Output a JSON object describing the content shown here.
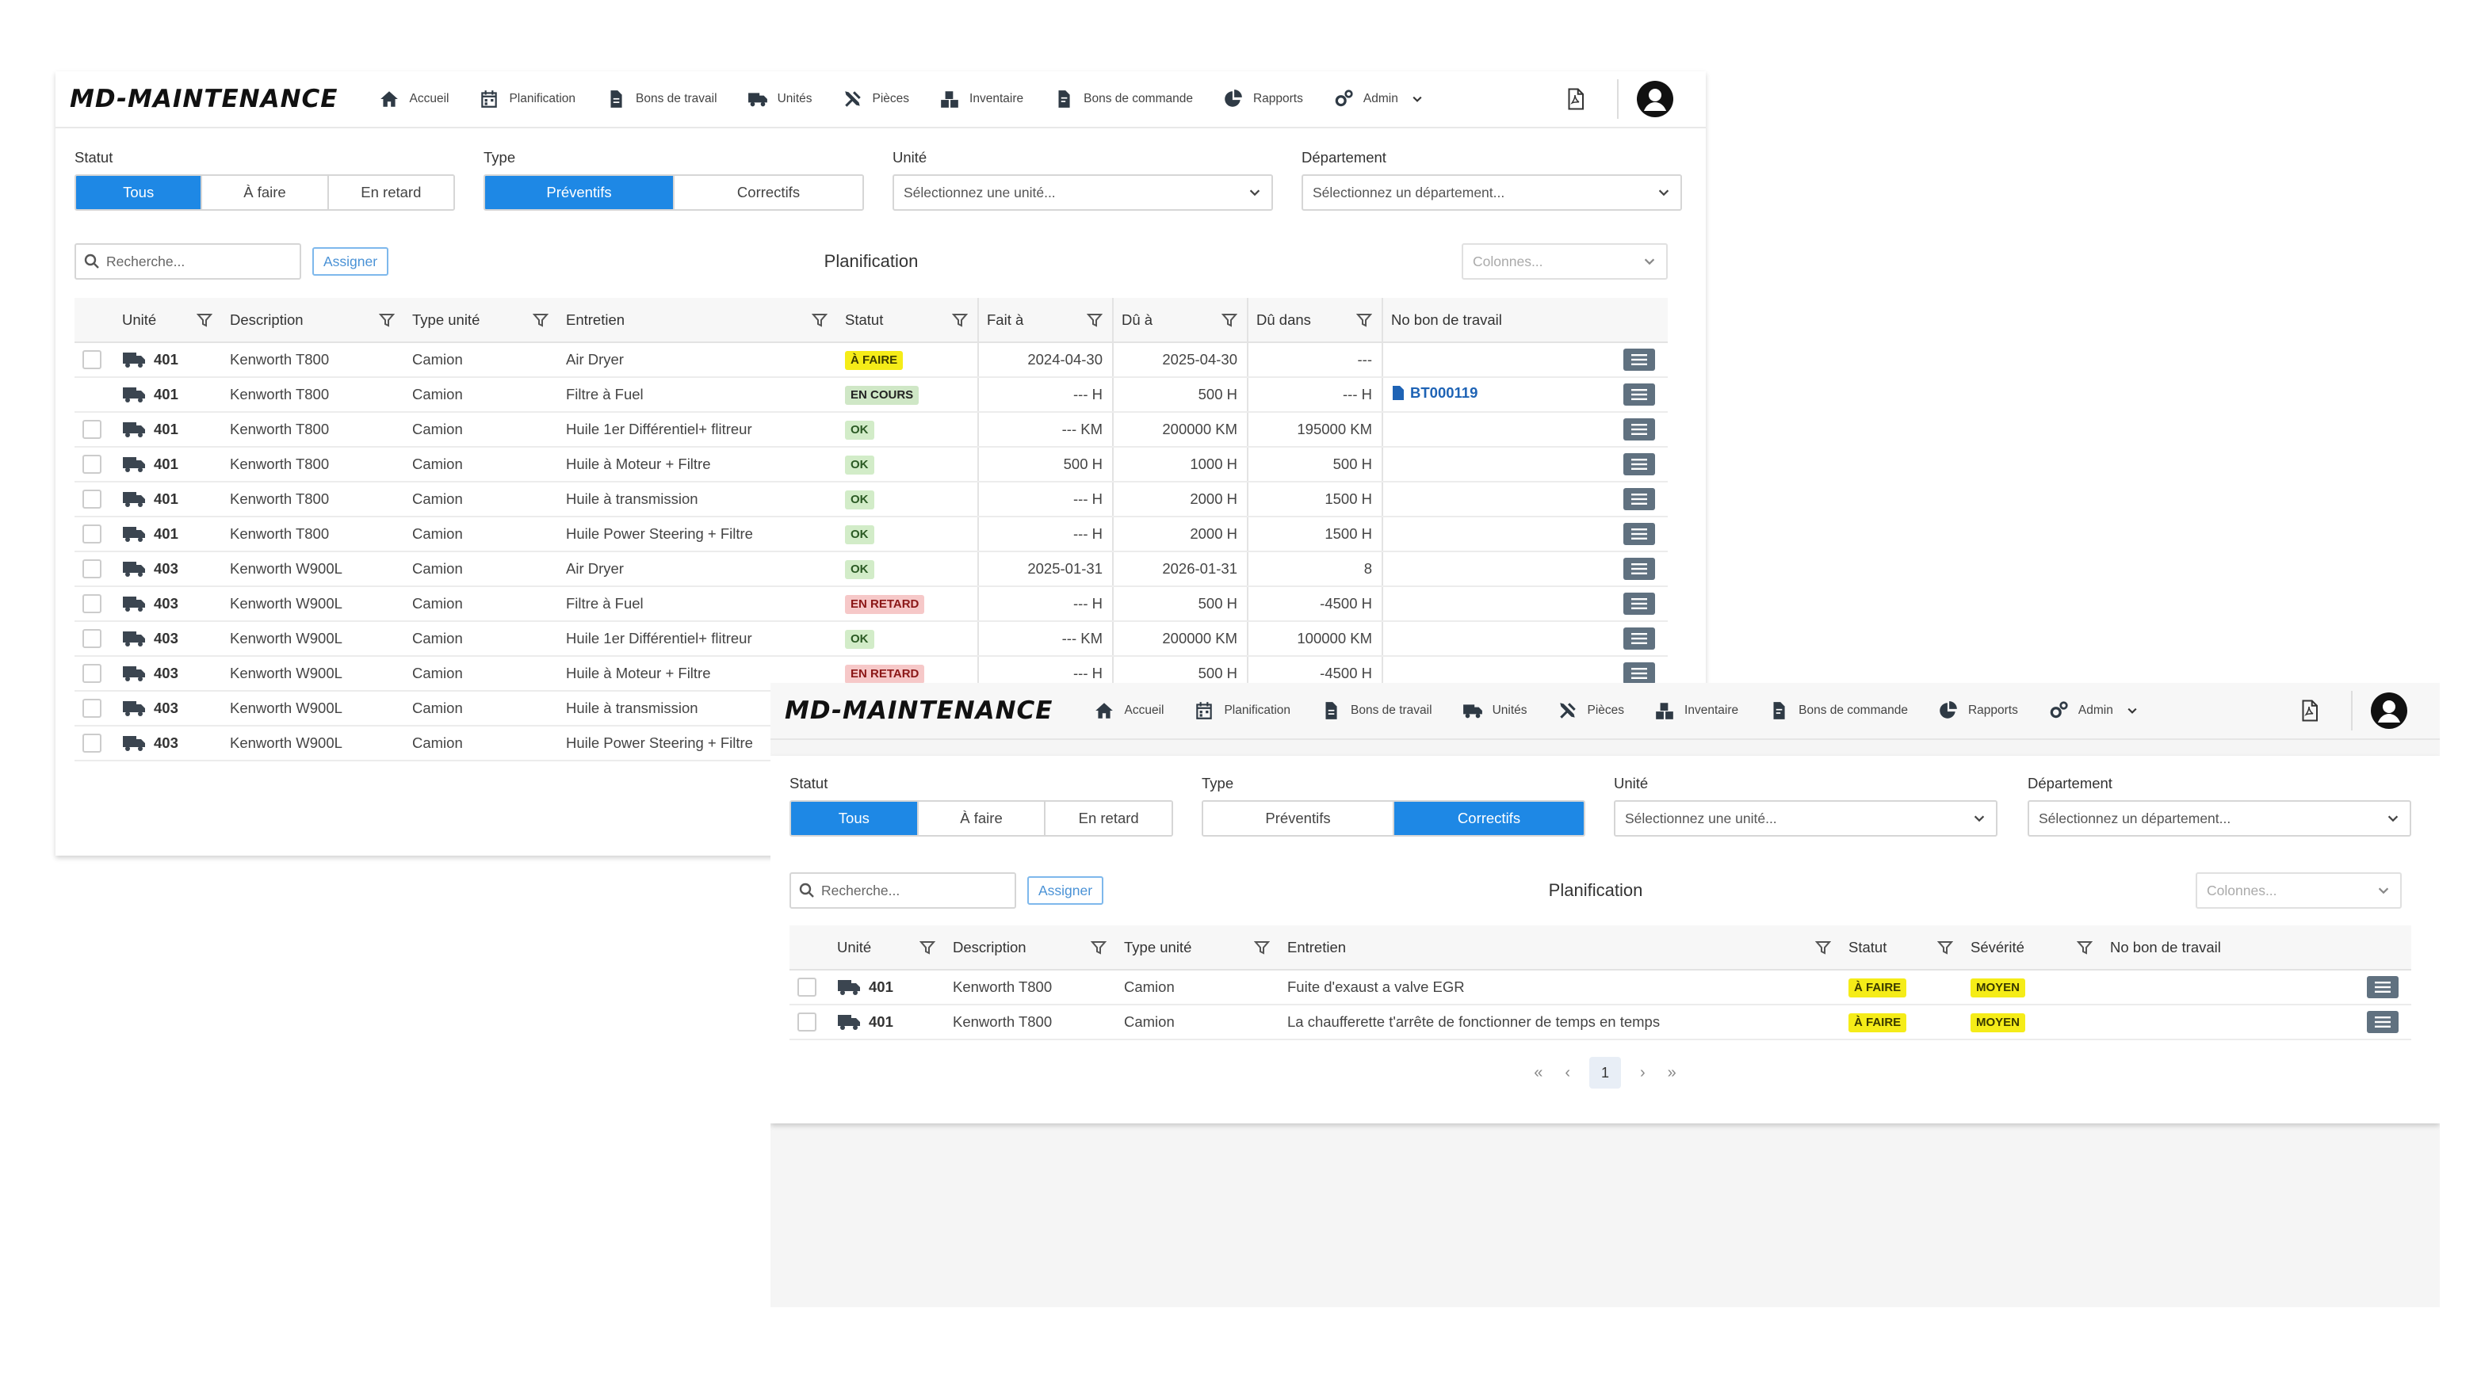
{
  "app": {
    "brand": "MD-MAINTENANCE"
  },
  "nav": {
    "items": [
      {
        "label": "Accueil",
        "icon": "home-icon"
      },
      {
        "label": "Planification",
        "icon": "calendar-icon"
      },
      {
        "label": "Bons de travail",
        "icon": "document-icon"
      },
      {
        "label": "Unités",
        "icon": "truck-icon"
      },
      {
        "label": "Pièces",
        "icon": "tools-icon"
      },
      {
        "label": "Inventaire",
        "icon": "boxes-icon"
      },
      {
        "label": "Bons de commande",
        "icon": "order-icon"
      },
      {
        "label": "Rapports",
        "icon": "chart-pie-icon"
      },
      {
        "label": "Admin",
        "icon": "gears-icon"
      }
    ]
  },
  "filters": {
    "statut_label": "Statut",
    "statut_options": [
      "Tous",
      "À faire",
      "En retard"
    ],
    "type_label": "Type",
    "type_options": [
      "Préventifs",
      "Correctifs"
    ],
    "unite_label": "Unité",
    "unite_placeholder": "Sélectionnez une unité...",
    "departement_label": "Département",
    "departement_placeholder": "Sélectionnez un département..."
  },
  "toolbar": {
    "search_placeholder": "Recherche...",
    "assign_label": "Assigner",
    "title": "Planification",
    "columns_placeholder": "Colonnes..."
  },
  "preventive": {
    "headers": [
      "Unité",
      "Description",
      "Type unité",
      "Entretien",
      "Statut",
      "Fait à",
      "Dû à",
      "Dû dans",
      "No bon de travail"
    ],
    "rows": [
      {
        "unit": "401",
        "desc": "Kenworth T800",
        "type": "Camion",
        "maint": "Air Dryer",
        "status": "À FAIRE",
        "status_kind": "afaire",
        "done": "2024-04-30",
        "due": "2025-04-30",
        "due_in": "---",
        "wo": ""
      },
      {
        "unit": "401",
        "desc": "Kenworth T800",
        "type": "Camion",
        "maint": "Filtre à Fuel",
        "status": "EN COURS",
        "status_kind": "encours",
        "done": "--- H",
        "due": "500 H",
        "due_in": "--- H",
        "wo": "BT000119"
      },
      {
        "unit": "401",
        "desc": "Kenworth T800",
        "type": "Camion",
        "maint": "Huile 1er Différentiel+ flitreur",
        "status": "OK",
        "status_kind": "ok",
        "done": "--- KM",
        "due": "200000 KM",
        "due_in": "195000 KM",
        "wo": ""
      },
      {
        "unit": "401",
        "desc": "Kenworth T800",
        "type": "Camion",
        "maint": "Huile à Moteur + Filtre",
        "status": "OK",
        "status_kind": "ok",
        "done": "500 H",
        "due": "1000 H",
        "due_in": "500 H",
        "wo": ""
      },
      {
        "unit": "401",
        "desc": "Kenworth T800",
        "type": "Camion",
        "maint": "Huile à transmission",
        "status": "OK",
        "status_kind": "ok",
        "done": "--- H",
        "due": "2000 H",
        "due_in": "1500 H",
        "wo": ""
      },
      {
        "unit": "401",
        "desc": "Kenworth T800",
        "type": "Camion",
        "maint": "Huile Power Steering + Filtre",
        "status": "OK",
        "status_kind": "ok",
        "done": "--- H",
        "due": "2000 H",
        "due_in": "1500 H",
        "wo": ""
      },
      {
        "unit": "403",
        "desc": "Kenworth W900L",
        "type": "Camion",
        "maint": "Air Dryer",
        "status": "OK",
        "status_kind": "ok",
        "done": "2025-01-31",
        "due": "2026-01-31",
        "due_in": "8",
        "wo": ""
      },
      {
        "unit": "403",
        "desc": "Kenworth W900L",
        "type": "Camion",
        "maint": "Filtre à Fuel",
        "status": "EN RETARD",
        "status_kind": "retard",
        "done": "--- H",
        "due": "500 H",
        "due_in": "-4500 H",
        "wo": ""
      },
      {
        "unit": "403",
        "desc": "Kenworth W900L",
        "type": "Camion",
        "maint": "Huile 1er Différentiel+ flitreur",
        "status": "OK",
        "status_kind": "ok",
        "done": "--- KM",
        "due": "200000 KM",
        "due_in": "100000 KM",
        "wo": ""
      },
      {
        "unit": "403",
        "desc": "Kenworth W900L",
        "type": "Camion",
        "maint": "Huile à Moteur + Filtre",
        "status": "EN RETARD",
        "status_kind": "retard",
        "done": "--- H",
        "due": "500 H",
        "due_in": "-4500 H",
        "wo": ""
      },
      {
        "unit": "403",
        "desc": "Kenworth W900L",
        "type": "Camion",
        "maint": "Huile à transmission",
        "status": "",
        "status_kind": "",
        "done": "",
        "due": "",
        "due_in": "",
        "wo": ""
      },
      {
        "unit": "403",
        "desc": "Kenworth W900L",
        "type": "Camion",
        "maint": "Huile Power Steering + Filtre",
        "status": "",
        "status_kind": "",
        "done": "",
        "due": "",
        "due_in": "",
        "wo": ""
      }
    ]
  },
  "corrective": {
    "headers": [
      "Unité",
      "Description",
      "Type unité",
      "Entretien",
      "Statut",
      "Sévérité",
      "No bon de travail"
    ],
    "rows": [
      {
        "unit": "401",
        "desc": "Kenworth T800",
        "type": "Camion",
        "maint": "Fuite d'exaust a valve EGR",
        "status": "À FAIRE",
        "severity": "MOYEN"
      },
      {
        "unit": "401",
        "desc": "Kenworth T800",
        "type": "Camion",
        "maint": "La chaufferette t'arrête de fonctionner de temps en temps",
        "status": "À FAIRE",
        "severity": "MOYEN"
      }
    ]
  },
  "pager": {
    "first": "«",
    "prev": "‹",
    "current": "1",
    "next": "›",
    "last": "»"
  },
  "colors": {
    "accent": "#1e88e5",
    "menu_button": "#607180"
  }
}
